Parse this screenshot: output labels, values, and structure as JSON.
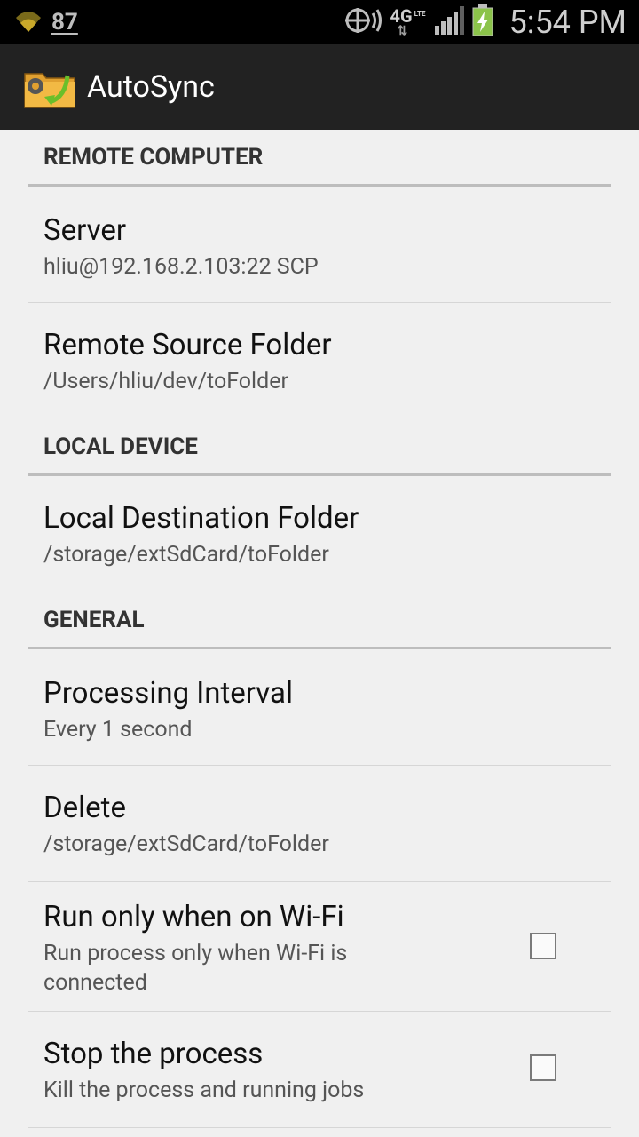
{
  "status_bar": {
    "notification_count": "87",
    "network": "4G",
    "network_sub": "LTE",
    "time": "5:54 PM"
  },
  "action_bar": {
    "title": "AutoSync"
  },
  "sections": {
    "remote": {
      "header": "REMOTE COMPUTER",
      "server_title": "Server",
      "server_summary": "hliu@192.168.2.103:22 SCP",
      "source_title": "Remote Source Folder",
      "source_summary": "/Users/hliu/dev/toFolder"
    },
    "local": {
      "header": "LOCAL DEVICE",
      "dest_title": "Local Destination Folder",
      "dest_summary": "/storage/extSdCard/toFolder"
    },
    "general": {
      "header": "GENERAL",
      "interval_title": "Processing Interval",
      "interval_summary": "Every 1 second",
      "delete_title": "Delete",
      "delete_summary": "/storage/extSdCard/toFolder",
      "wifi_title": "Run only when on Wi-Fi",
      "wifi_summary": "Run process only when Wi-Fi is connected",
      "stop_title": "Stop the process",
      "stop_summary": "Kill the process and running jobs"
    }
  },
  "checkbox_states": {
    "wifi_only": false,
    "stop_process": false
  },
  "colors": {
    "action_bar": "#222222",
    "background": "#f0f0f0",
    "battery": "#8bc34a",
    "icon_folder": "#e0a030",
    "icon_arrow": "#6abf2a"
  }
}
